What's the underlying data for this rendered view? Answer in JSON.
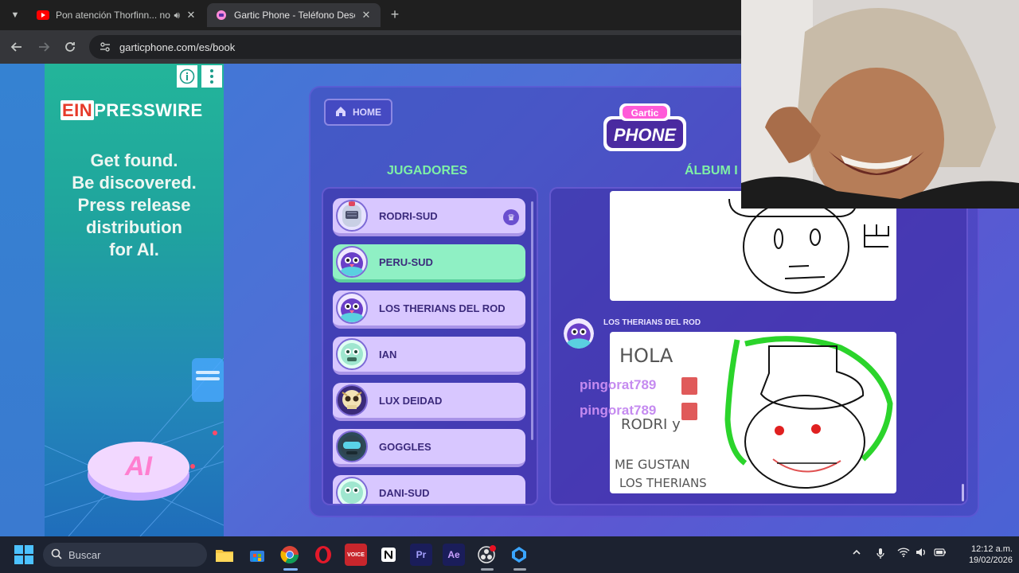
{
  "browser": {
    "tabs": [
      {
        "title": "Pon atención Thorfinn... no",
        "favicon": "youtube-icon",
        "state": "inactive"
      },
      {
        "title": "Gartic Phone - Teléfono Descon",
        "favicon": "gartic-icon",
        "state": "active"
      }
    ],
    "url": "garticphone.com/es/book"
  },
  "ad": {
    "brand_prefix": "EIN",
    "brand_suffix": "PRESSWIRE",
    "headline": [
      "Get found.",
      "Be discovered.",
      "Press release",
      "distribution",
      "for AI."
    ],
    "badge_text": "AI"
  },
  "game": {
    "home_label": "HOME",
    "logo_top": "Gartic",
    "logo_bottom": "PHONE",
    "players_heading": "JUGADORES",
    "album_heading": "ÁLBUM I",
    "players": [
      {
        "name": "RODRI-SUD",
        "avatar": "knight",
        "host": true,
        "active": false
      },
      {
        "name": "PERU-SUD",
        "avatar": "bird",
        "host": false,
        "active": true
      },
      {
        "name": "LOS THERIANS DEL ROD",
        "avatar": "bird",
        "host": false,
        "active": false
      },
      {
        "name": "IAN",
        "avatar": "ghost",
        "host": false,
        "active": false
      },
      {
        "name": "LUX DEIDAD",
        "avatar": "skull",
        "host": false,
        "active": false
      },
      {
        "name": "GOGGLES",
        "avatar": "goggles",
        "host": false,
        "active": false
      },
      {
        "name": "DANI-SUD",
        "avatar": "ghost",
        "host": false,
        "active": false
      }
    ],
    "album_author": "LOS THERIANS DEL ROD",
    "drawing_text": [
      "HOLA",
      "RODRI y",
      "ME GUSTAN",
      "LOS THERIANS"
    ]
  },
  "stream_overlay": {
    "messages": [
      "pingorat789",
      "pingorat789"
    ]
  },
  "taskbar": {
    "search_placeholder": "Buscar",
    "apps": [
      "file-explorer-icon",
      "store-icon",
      "chrome-icon",
      "opera-icon",
      "voicemeeter-icon",
      "notion-icon",
      "premiere-icon",
      "after-effects-icon",
      "obs-icon",
      "app-icon"
    ],
    "premiere_label": "Pr",
    "after_effects_label": "Ae",
    "voicemeeter_label": "VOICE",
    "time": "12:12 a.m.",
    "date": "19/02/2026"
  },
  "colors": {
    "heading_green": "#7ff0a6",
    "player_card": "#d8c7ff",
    "player_active": "#8ff0c4",
    "page_blue": "#4f6fd6"
  }
}
